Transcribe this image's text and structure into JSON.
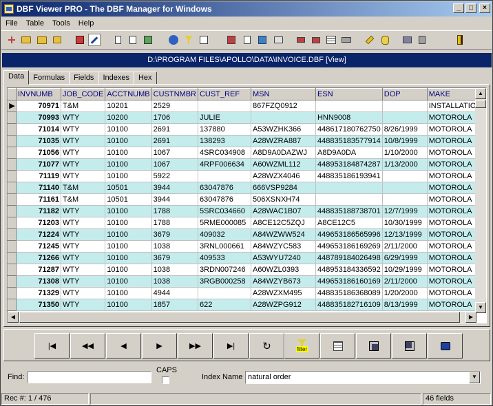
{
  "window": {
    "title": "DBF Viewer PRO - The DBF Manager for Windows",
    "minimize": "_",
    "maximize": "□",
    "close": "×"
  },
  "menu": [
    "File",
    "Table",
    "Tools",
    "Help"
  ],
  "path": "D:\\PROGRAM FILES\\APOLLO\\DATA\\INVOICE.DBF [View]",
  "tabs": [
    "Data",
    "Formulas",
    "Fields",
    "Indexes",
    "Hex"
  ],
  "grid": {
    "columns": [
      "INVNUMB",
      "JOB_CODE",
      "ACCTNUMB",
      "CUSTNMBR",
      "CUST_REF",
      "MSN",
      "ESN",
      "DOP",
      "MAKE"
    ],
    "rows": [
      [
        "70971",
        "T&M",
        "10201",
        "2529",
        "",
        "867FZQ0912",
        "",
        "",
        "INSTALLATION"
      ],
      [
        "70993",
        "WTY",
        "10200",
        "1706",
        "JULIE",
        "",
        "HNN9008",
        "",
        "MOTOROLA"
      ],
      [
        "71014",
        "WTY",
        "10100",
        "2691",
        "137880",
        "A53WZHK366",
        "448617180762750",
        "8/26/1999",
        "MOTOROLA"
      ],
      [
        "71035",
        "WTY",
        "10100",
        "2691",
        "138293",
        "A28WZRA887",
        "448835183577914",
        "10/8/1999",
        "MOTOROLA"
      ],
      [
        "71056",
        "WTY",
        "10100",
        "1067",
        "4SRC034908",
        "A8D9A0DAZWJ",
        "A8D9A0DA",
        "1/10/2000",
        "MOTOROLA"
      ],
      [
        "71077",
        "WTY",
        "10100",
        "1067",
        "4RPF006634",
        "A60WZML112",
        "448953184874287",
        "1/13/2000",
        "MOTOROLA"
      ],
      [
        "71119",
        "WTY",
        "10100",
        "5922",
        "",
        "A28WZX4046",
        "448835186193941",
        "",
        "MOTOROLA"
      ],
      [
        "71140",
        "T&M",
        "10501",
        "3944",
        "63047876",
        "666VSP9284",
        "",
        "",
        "MOTOROLA"
      ],
      [
        "71161",
        "T&M",
        "10501",
        "3944",
        "63047876",
        "506XSNXH74",
        "",
        "",
        "MOTOROLA"
      ],
      [
        "71182",
        "WTY",
        "10100",
        "1788",
        "5SRC034660",
        "A28WAC1B07",
        "448835188738701",
        "12/7/1999",
        "MOTOROLA"
      ],
      [
        "71203",
        "WTY",
        "10100",
        "1788",
        "5RME000085",
        "A8CE12C5ZQJ",
        "A8CE12C5",
        "10/30/1999",
        "MOTOROLA"
      ],
      [
        "71224",
        "WTY",
        "10100",
        "3679",
        "409032",
        "A84WZWW524",
        "449653186565996",
        "12/13/1999",
        "MOTOROLA"
      ],
      [
        "71245",
        "WTY",
        "10100",
        "1038",
        "3RNL000661",
        "A84WZYC583",
        "449653186169269",
        "2/11/2000",
        "MOTOROLA"
      ],
      [
        "71266",
        "WTY",
        "10100",
        "3679",
        "409533",
        "A53WYU7240",
        "448789184026498",
        "6/29/1999",
        "MOTOROLA"
      ],
      [
        "71287",
        "WTY",
        "10100",
        "1038",
        "3RDN007246",
        "A60WZL0393",
        "448953184336592",
        "10/29/1999",
        "MOTOROLA"
      ],
      [
        "71308",
        "WTY",
        "10100",
        "1038",
        "3RGB000258",
        "A84WZYB673",
        "449653186160169",
        "2/11/2000",
        "MOTOROLA"
      ],
      [
        "71329",
        "WTY",
        "10100",
        "4944",
        "",
        "A28WZXM495",
        "448835186368089",
        "1/20/2000",
        "MOTOROLA"
      ],
      [
        "71350",
        "WTY",
        "10100",
        "1857",
        "622",
        "A28WZPG912",
        "448835182716109",
        "8/13/1999",
        "MOTOROLA"
      ]
    ]
  },
  "nav": {
    "first": "|◀",
    "prior_page": "◀◀",
    "prior": "◀",
    "next": "▶",
    "next_page": "▶▶",
    "last": "▶|",
    "refresh": "↻",
    "filter_label": "filter"
  },
  "find": {
    "label": "Find:",
    "value": "",
    "caps_label": "CAPS",
    "index_label": "Index Name",
    "index_value": "natural order"
  },
  "status": {
    "rec": "Rec #: 1 / 476",
    "fields": "46 fields"
  },
  "colors": {
    "title_start": "#0a246a",
    "title_end": "#a6caf0",
    "row_alt": "#c5ecec",
    "path_bar": "#0a246a"
  }
}
